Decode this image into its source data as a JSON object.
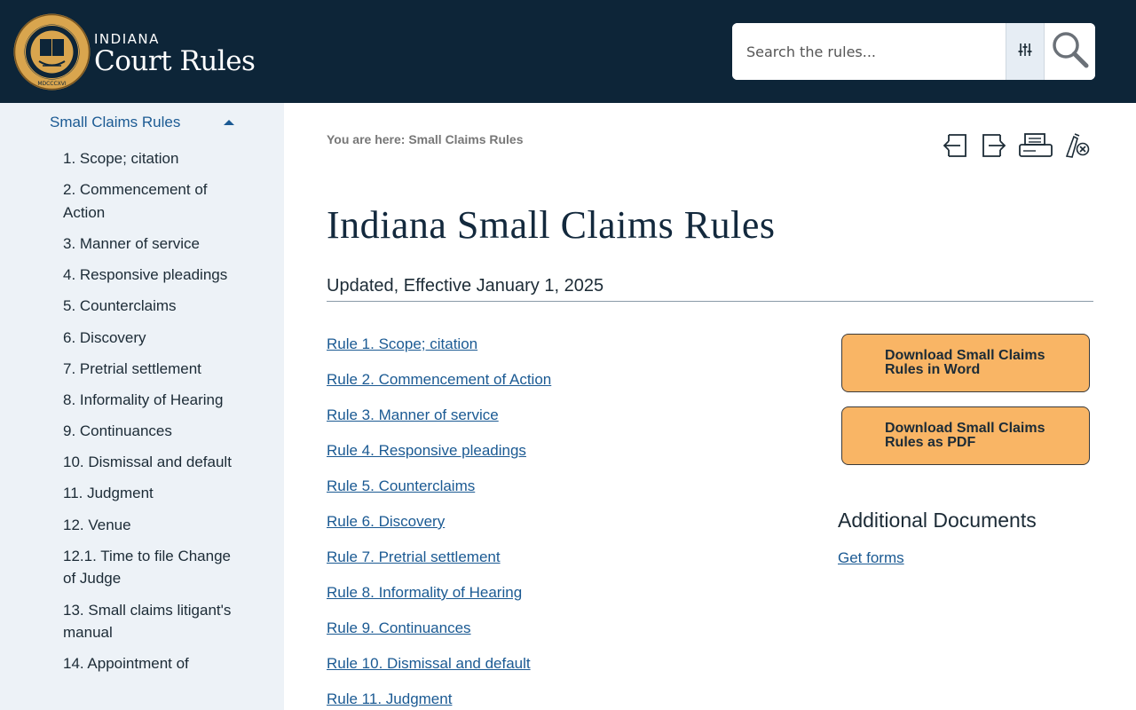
{
  "header": {
    "logo_top": "INDIANA",
    "logo_main": "Court Rules",
    "logo_seal_text": "SUPREME COURT · STATE OF INDIANA · MDCCCXVI",
    "search_placeholder": "Search the rules..."
  },
  "sidebar": {
    "section_title": "Small Claims Rules",
    "items": [
      "1. Scope; citation",
      "2. Commencement of Action",
      "3. Manner of service",
      "4. Responsive pleadings",
      "5. Counterclaims",
      "6. Discovery",
      "7. Pretrial settlement",
      "8. Informality of Hearing",
      "9. Continuances",
      "10. Dismissal and default",
      "11. Judgment",
      "12. Venue",
      "12.1. Time to file Change of Judge",
      "13. Small claims litigant's manual",
      "14. Appointment of"
    ]
  },
  "main": {
    "breadcrumb": "You are here: Small Claims Rules",
    "title": "Indiana Small Claims Rules",
    "updated": "Updated, Effective January 1, 2025",
    "rules": [
      "Rule 1. Scope; citation",
      "Rule 2. Commencement of Action",
      "Rule 3. Manner of service",
      "Rule 4. Responsive pleadings",
      "Rule 5. Counterclaims",
      "Rule 6. Discovery",
      "Rule 7. Pretrial settlement",
      "Rule 8. Informality of Hearing",
      "Rule 9. Continuances",
      "Rule 10. Dismissal and default",
      "Rule 11. Judgment"
    ],
    "download_word": "Download Small Claims Rules in Word",
    "download_pdf": "Download Small Claims Rules as PDF",
    "additional_heading": "Additional Documents",
    "get_forms": "Get forms"
  },
  "colors": {
    "header_bg": "#0d2538",
    "sidebar_bg": "#edf2f7",
    "link": "#1b5a93",
    "button_bg": "#f9b565",
    "seal_gold": "#d9a54e"
  }
}
